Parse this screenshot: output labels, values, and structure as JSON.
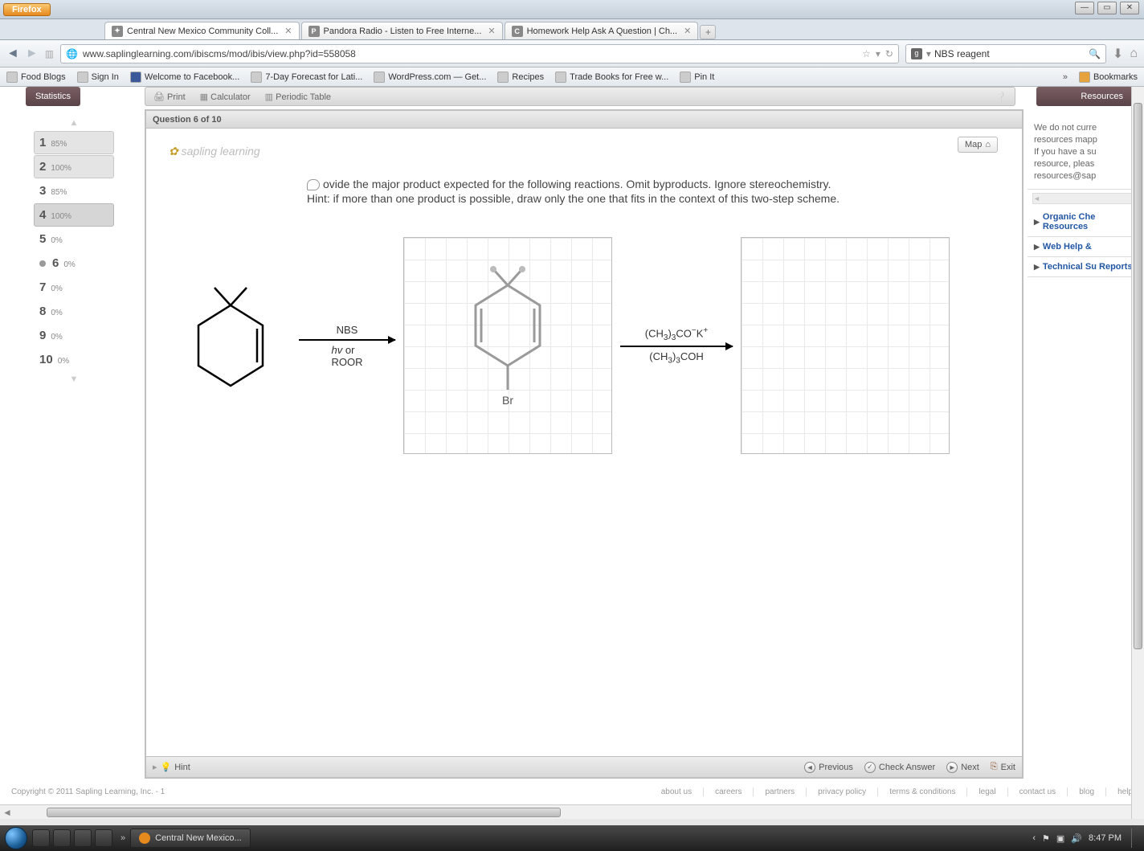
{
  "firefox": {
    "button": "Firefox",
    "tabs": [
      {
        "label": "Central New Mexico Community Coll...",
        "favicon": "✦",
        "active": true
      },
      {
        "label": "Pandora Radio - Listen to Free Interne...",
        "favicon": "P"
      },
      {
        "label": "Homework Help Ask A Question | Ch...",
        "favicon": "C"
      }
    ],
    "url": "www.saplinglearning.com/ibiscms/mod/ibis/view.php?id=558058",
    "search": {
      "engine": "g",
      "query": "NBS reagent"
    },
    "bookmarks": [
      "Food Blogs",
      "Sign In",
      "Welcome to Facebook...",
      "7-Day Forecast for Lati...",
      "WordPress.com — Get...",
      "Recipes",
      "Trade Books for Free w...",
      "Pin It"
    ],
    "bm_more": "Bookmarks"
  },
  "sapling": {
    "statistics": "Statistics",
    "resources_label": "Resources",
    "toolbar": {
      "print": "Print",
      "calc": "Calculator",
      "table": "Periodic Table"
    },
    "question_header": "Question 6 of 10",
    "brand": "sapling learning",
    "map": "Map",
    "prompt_line1": "ovide the major product expected for the following reactions. Omit byproducts. Ignore stereochemistry.",
    "prompt_line2": "Hint: if more than one product is possible, draw only the one that fits in the context of this two-step scheme.",
    "arrow1": {
      "above": "NBS",
      "below": "hv or\nROOR"
    },
    "arrow2": {
      "above": "(CH3)3CO⁻K⁺",
      "below": "(CH3)3COH"
    },
    "br_label": "Br",
    "footer": {
      "hint": "Hint",
      "prev": "Previous",
      "check": "Check Answer",
      "next": "Next",
      "exit": "Exit"
    },
    "qnav": [
      {
        "n": "1",
        "pct": "85%",
        "sel": true
      },
      {
        "n": "2",
        "pct": "100%",
        "sel": true
      },
      {
        "n": "3",
        "pct": "85%"
      },
      {
        "n": "4",
        "pct": "100%",
        "sel": true,
        "hard": true
      },
      {
        "n": "5",
        "pct": "0%"
      },
      {
        "n": "6",
        "pct": "0%",
        "current": true
      },
      {
        "n": "7",
        "pct": "0%"
      },
      {
        "n": "8",
        "pct": "0%"
      },
      {
        "n": "9",
        "pct": "0%"
      },
      {
        "n": "10",
        "pct": "0%"
      }
    ],
    "resources": {
      "text": "We do not curre\nresources mapp\nIf you have a su\nresource, pleas\nresources@sap",
      "links": [
        "Organic Che Resources",
        "Web Help &",
        "Technical Su Reports"
      ]
    },
    "copyright": "Copyright © 2011 Sapling Learning, Inc. - 1",
    "foot_links": [
      "about us",
      "careers",
      "partners",
      "privacy policy",
      "terms & conditions",
      "legal",
      "contact us",
      "blog",
      "help"
    ]
  },
  "taskbar": {
    "app": "Central New Mexico...",
    "time": "8:47 PM"
  }
}
